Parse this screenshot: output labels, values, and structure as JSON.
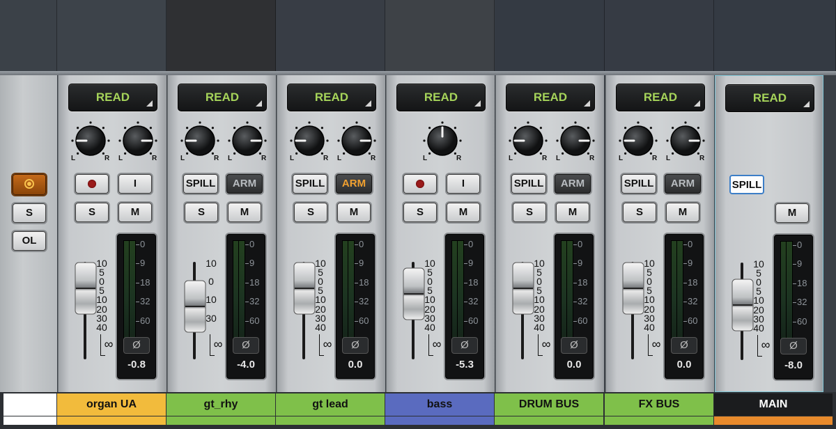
{
  "top_colors": [
    "#3b4148",
    "#3d434a",
    "#2f3033",
    "#383d45",
    "#3e4247",
    "#343a43",
    "#363b44",
    "#343a43"
  ],
  "channels": [
    {
      "name": "organ UA",
      "color": "#f2bb3c",
      "knobs": 2,
      "rec": true,
      "input_label": "I",
      "arm_state": "none",
      "spill": false,
      "solo_label": "S",
      "mute_label": "M",
      "fader": 0.36,
      "meter_scale": [
        "0",
        "9",
        "18",
        "32",
        "60"
      ],
      "fader_scale": [
        "10",
        "5",
        "0",
        "5",
        "10",
        "20",
        "30",
        "40"
      ],
      "infinity": "∞",
      "phase": "Ø",
      "gain": "-0.8",
      "automation": "READ"
    },
    {
      "name": "gt_rhy",
      "color": "#7fc04a",
      "knobs": 2,
      "rec": false,
      "input_label": "",
      "arm_state": "off",
      "spill": true,
      "solo_label": "S",
      "mute_label": "M",
      "fader": 0.64,
      "meter_scale": [
        "0",
        "9",
        "18",
        "32",
        "60"
      ],
      "fader_scale": [
        "10",
        "",
        "0",
        "",
        "10",
        "",
        "30",
        ""
      ],
      "infinity": "∞",
      "phase": "Ø",
      "gain": "-4.0",
      "automation": "READ"
    },
    {
      "name": "gt lead",
      "color": "#7fc04a",
      "knobs": 2,
      "rec": false,
      "input_label": "",
      "arm_state": "on",
      "spill": true,
      "solo_label": "S",
      "mute_label": "M",
      "fader": 0.36,
      "meter_scale": [
        "0",
        "9",
        "18",
        "32",
        "60"
      ],
      "fader_scale": [
        "10",
        "5",
        "0",
        "5",
        "10",
        "20",
        "30",
        "40"
      ],
      "infinity": "∞",
      "phase": "Ø",
      "gain": "0.0",
      "automation": "READ"
    },
    {
      "name": "bass",
      "color": "#5a6bbf",
      "knobs": 1,
      "rec": true,
      "input_label": "I",
      "arm_state": "none",
      "spill": false,
      "solo_label": "S",
      "mute_label": "M",
      "fader": 0.45,
      "meter_scale": [
        "0",
        "9",
        "18",
        "32",
        "60"
      ],
      "fader_scale": [
        "10",
        "5",
        "0",
        "5",
        "10",
        "20",
        "30",
        "40"
      ],
      "infinity": "∞",
      "phase": "Ø",
      "gain": "-5.3",
      "automation": "READ"
    },
    {
      "name": "DRUM BUS",
      "color": "#7fc04a",
      "knobs": 2,
      "rec": false,
      "input_label": "",
      "arm_state": "off",
      "spill": true,
      "solo_label": "S",
      "mute_label": "M",
      "fader": 0.36,
      "meter_scale": [
        "0",
        "9",
        "18",
        "32",
        "60"
      ],
      "fader_scale": [
        "10",
        "5",
        "0",
        "5",
        "10",
        "20",
        "30",
        "40"
      ],
      "infinity": "∞",
      "phase": "Ø",
      "gain": "0.0",
      "automation": "READ"
    },
    {
      "name": "FX BUS",
      "color": "#7fc04a",
      "knobs": 2,
      "rec": false,
      "input_label": "",
      "arm_state": "off",
      "spill": true,
      "solo_label": "S",
      "mute_label": "M",
      "fader": 0.36,
      "meter_scale": [
        "0",
        "9",
        "18",
        "32",
        "60"
      ],
      "fader_scale": [
        "10",
        "5",
        "0",
        "5",
        "10",
        "20",
        "30",
        "40"
      ],
      "infinity": "∞",
      "phase": "Ø",
      "gain": "0.0",
      "automation": "READ"
    },
    {
      "name": "MAIN",
      "color": "#1b1c1e",
      "knobs": 0,
      "rec": false,
      "input_label": "",
      "arm_state": "main",
      "spill": true,
      "solo_label": "",
      "mute_label": "M",
      "fader": 0.6,
      "meter_scale": [
        "0",
        "9",
        "18",
        "32",
        "60"
      ],
      "fader_scale": [
        "10",
        "5",
        "0",
        "5",
        "10",
        "20",
        "30",
        "40"
      ],
      "infinity": "∞",
      "phase": "Ø",
      "gain": "-8.0",
      "automation": "READ"
    }
  ],
  "labels": {
    "spill": "SPILL",
    "arm": "ARM",
    "left": "L",
    "right": "R"
  },
  "left_panel": {
    "solo": "S",
    "overload": "OL"
  }
}
